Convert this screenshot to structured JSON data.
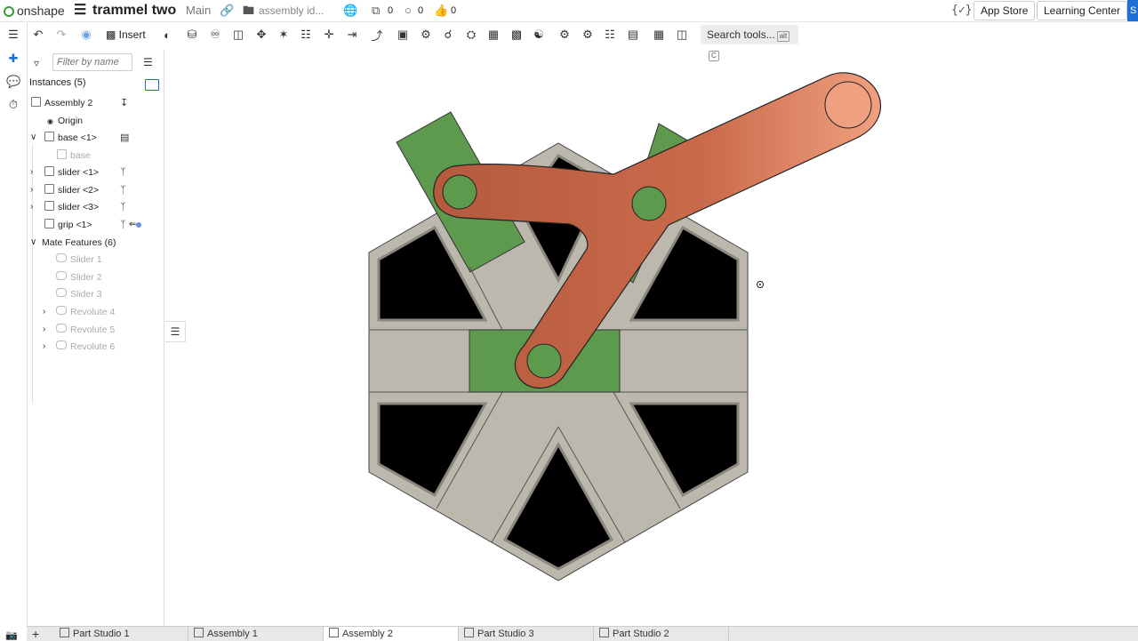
{
  "topbar": {
    "brand": "onshape",
    "doc_title": "trammel two",
    "branch": "Main",
    "folder": "assembly id...",
    "versions_count": "0",
    "branches_count": "0",
    "likes_count": "0",
    "app_store": "App Store",
    "learning_center": "Learning Center",
    "edge_label": "S"
  },
  "toolbar": {
    "insert_label": "Insert",
    "search_label": "Search tools...",
    "kbd_alt": "alt",
    "kbd_c": "C"
  },
  "panel": {
    "filter_placeholder": "Filter by name",
    "instances_header": "Instances (5)",
    "items": [
      {
        "label": "Assembly 2"
      },
      {
        "label": "Origin"
      },
      {
        "label": "base <1>"
      },
      {
        "label": "base"
      },
      {
        "label": "slider <1>"
      },
      {
        "label": "slider <2>"
      },
      {
        "label": "slider <3>"
      },
      {
        "label": "grip <1>"
      },
      {
        "label": "Mate Features (6)"
      },
      {
        "label": "Slider 1"
      },
      {
        "label": "Slider 2"
      },
      {
        "label": "Slider 3"
      },
      {
        "label": "Revolute 4"
      },
      {
        "label": "Revolute 5"
      },
      {
        "label": "Revolute 6"
      }
    ]
  },
  "tabs": [
    {
      "label": "Part Studio 1"
    },
    {
      "label": "Assembly 1"
    },
    {
      "label": "Assembly 2",
      "active": true
    },
    {
      "label": "Part Studio 3"
    },
    {
      "label": "Part Studio 2"
    }
  ],
  "colors": {
    "accent": "#1d6fd6",
    "base_body": "#bcb8ad",
    "cutout": "#000000",
    "slider_green": "#5e9a4e",
    "grip_orange": "#c35f40",
    "grip_highlight": "#f0a080"
  }
}
